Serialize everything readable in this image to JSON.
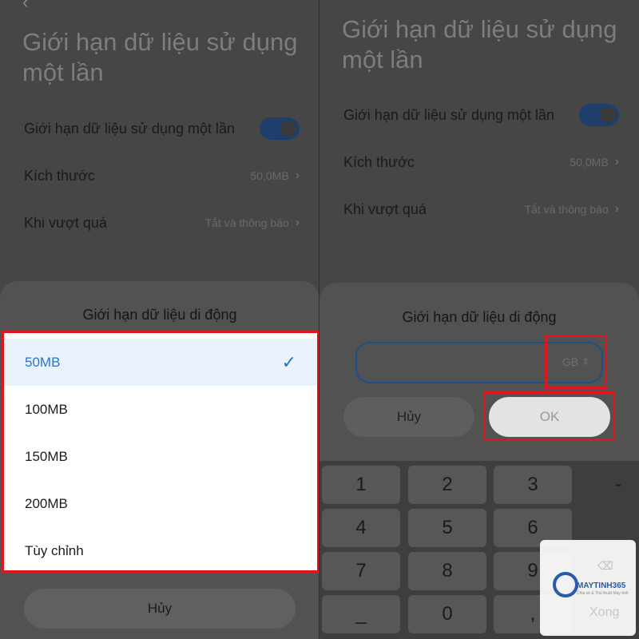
{
  "left": {
    "page_title": "Giới hạn dữ liệu sử dụng một lần",
    "rows": {
      "toggle_label": "Giới hạn dữ liệu sử dụng một lần",
      "size_label": "Kích thước",
      "size_value": "50,0MB",
      "exceed_label": "Khi vượt quá",
      "exceed_value": "Tắt và thông báo"
    },
    "sheet": {
      "title": "Giới hạn dữ liệu di động",
      "options": [
        "50MB",
        "100MB",
        "150MB",
        "200MB",
        "Tùy chỉnh"
      ],
      "selected_index": 0,
      "cancel_label": "Hủy"
    }
  },
  "right": {
    "page_title": "Giới hạn dữ liệu sử dụng một lần",
    "rows": {
      "toggle_label": "Giới hạn dữ liệu sử dụng một lần",
      "size_label": "Kích thước",
      "size_value": "50,0MB",
      "exceed_label": "Khi vượt quá",
      "exceed_value": "Tắt và thông báo"
    },
    "sheet": {
      "title": "Giới hạn dữ liệu di động",
      "input_value": "",
      "unit": "GB",
      "cancel_label": "Hủy",
      "ok_label": "OK"
    },
    "keypad": {
      "keys": [
        "1",
        "2",
        "3",
        "-",
        "4",
        "5",
        "6",
        "7",
        "8",
        "9",
        "0"
      ],
      "done_label": "Xong"
    }
  },
  "watermark": {
    "brand": "MAYTINH365",
    "tagline": "Chia sẻ & Thủ thuật Máy tính"
  },
  "colors": {
    "accent_blue": "#2a74c8",
    "highlight_red": "#e0161e",
    "toggle_on": "#1e3e6c"
  },
  "icons": {
    "selected": "check-icon",
    "chevron": "chevron-right-icon",
    "unit_switch": "up-down-arrow-icon",
    "delete": "backspace-icon"
  }
}
